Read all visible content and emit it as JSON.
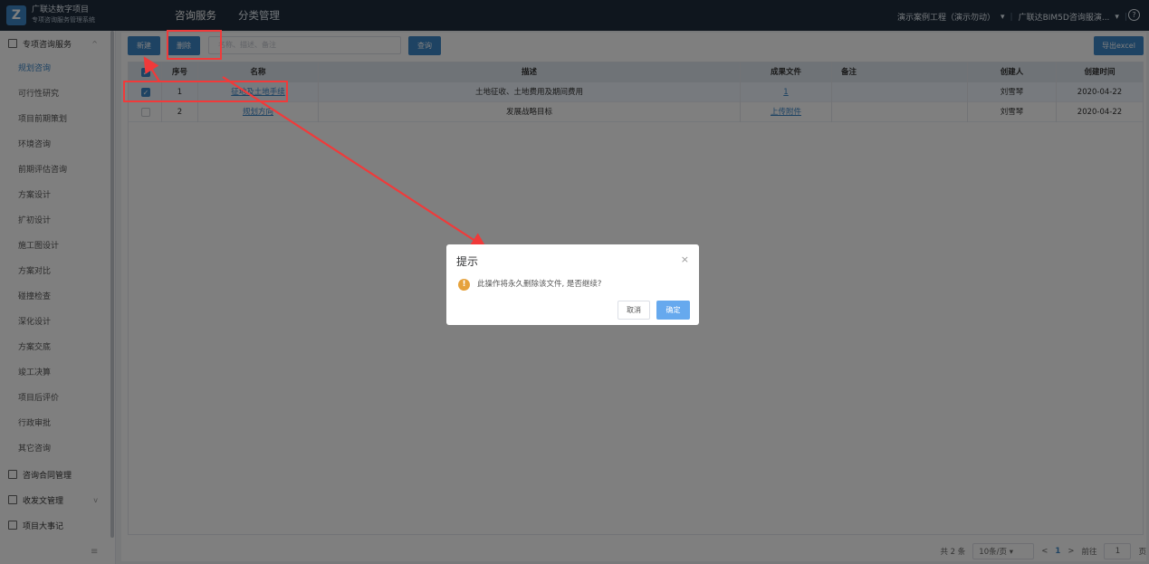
{
  "header": {
    "logo_letter": "Z",
    "logo_title": "广联达数字项目",
    "logo_subtitle": "专项咨询服务管理系统",
    "nav": [
      {
        "label": "咨询服务"
      },
      {
        "label": "分类管理"
      }
    ],
    "project": "演示案例工程（演示勿动）",
    "org": "广联达BIM5D咨询服演...",
    "help_glyph": "?"
  },
  "sidebar": {
    "groups": [
      {
        "label": "专项咨询服务",
        "chevron": "^"
      },
      {
        "label": "咨询合同管理"
      },
      {
        "label": "收发文管理",
        "chevron": "v"
      },
      {
        "label": "项目大事记"
      }
    ],
    "items": [
      {
        "label": "规划咨询"
      },
      {
        "label": "可行性研究"
      },
      {
        "label": "项目前期策划"
      },
      {
        "label": "环境咨询"
      },
      {
        "label": "前期评估咨询"
      },
      {
        "label": "方案设计"
      },
      {
        "label": "扩初设计"
      },
      {
        "label": "施工图设计"
      },
      {
        "label": "方案对比"
      },
      {
        "label": "碰撞检查"
      },
      {
        "label": "深化设计"
      },
      {
        "label": "方案交底"
      },
      {
        "label": "竣工决算"
      },
      {
        "label": "项目后评价"
      },
      {
        "label": "行政审批"
      },
      {
        "label": "其它咨询"
      }
    ],
    "menu_glyph": "≡"
  },
  "toolbar": {
    "new_label": "新建",
    "delete_label": "删除",
    "search_placeholder": "名称、描述、备注",
    "query_label": "查询",
    "export_label": "导出excel"
  },
  "table": {
    "columns": [
      "序号",
      "名称",
      "描述",
      "成果文件",
      "备注",
      "创建人",
      "创建时间"
    ],
    "rows": [
      {
        "checked": true,
        "index": "1",
        "name": "征地及土地手续",
        "desc": "土地征收、土地费用及期间费用",
        "file": "1",
        "note": "",
        "creator": "刘雪琴",
        "created": "2020-04-22"
      },
      {
        "checked": false,
        "index": "2",
        "name": "规划方向",
        "desc": "发展战略目标",
        "file": "上传附件",
        "note": "",
        "creator": "刘雪琴",
        "created": "2020-04-22"
      }
    ]
  },
  "pager": {
    "total": "共 2 条",
    "page_size": "10条/页",
    "prev": "<",
    "current": "1",
    "next": ">",
    "goto_label": "前往",
    "goto_value": "1",
    "page_suffix": "页"
  },
  "dialog": {
    "title": "提示",
    "close_glyph": "×",
    "warn_glyph": "!",
    "message": "此操作将永久删除该文件, 是否继续?",
    "cancel_label": "取消",
    "ok_label": "确定"
  },
  "colors": {
    "accent": "#3d86c6",
    "warning": "#e6a23c",
    "annotation": "#f03a3a"
  }
}
